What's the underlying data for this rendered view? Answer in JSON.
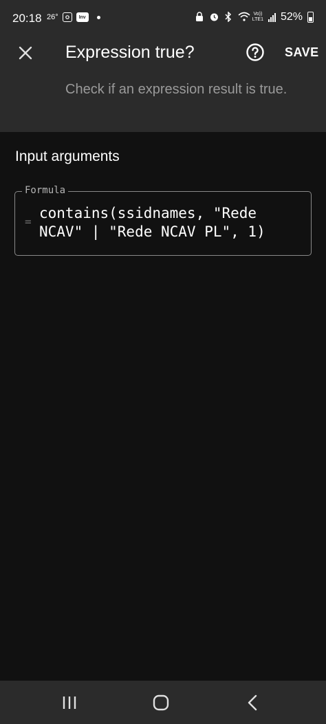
{
  "status_bar": {
    "time": "20:18",
    "temperature": "26°",
    "left_icons": [
      "instagram-icon",
      "inv-app-icon",
      "notification-dot-icon"
    ],
    "inv_label": "Inv",
    "network_label_top": "Vo))",
    "network_label_bottom": "LTE1",
    "battery": "52%"
  },
  "header": {
    "title": "Expression true?",
    "save_label": "SAVE",
    "subtitle": "Check if an expression result is true."
  },
  "content": {
    "section_title": "Input arguments",
    "formula": {
      "label": "Formula",
      "prefix": "=",
      "value": "contains(ssidnames, \"Rede NCAV\" | \"Rede NCAV PL\", 1)"
    }
  },
  "colors": {
    "background": "#111111",
    "header_bg": "#2b2b2b",
    "subtitle_text": "#9a9a9a",
    "outline": "#8a8a8a"
  }
}
